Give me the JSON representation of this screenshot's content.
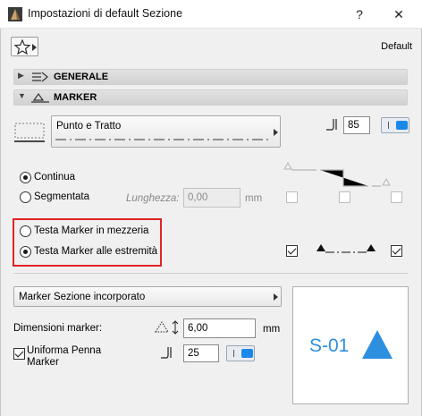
{
  "window": {
    "title": "Impostazioni di default Sezione",
    "help_label": "?",
    "close_label": "✕"
  },
  "toolbar": {
    "default_label": "Default"
  },
  "sections": {
    "generale": {
      "label": "GENERALE",
      "state": "collapsed"
    },
    "marker": {
      "label": "MARKER",
      "state": "expanded"
    }
  },
  "line": {
    "type_value": "Punto e Tratto",
    "pen_value": "85"
  },
  "style": {
    "continua_label": "Continua",
    "segmentata_label": "Segmentata",
    "lunghezza_label": "Lunghezza:",
    "lunghezza_value": "0,00",
    "lunghezza_unit": "mm",
    "selected": "continua"
  },
  "marker_position": {
    "mezzeria_label": "Testa Marker in mezzeria",
    "estremita_label": "Testa Marker alle estremità",
    "selected": "estremita"
  },
  "marker_type": {
    "value": "Marker Sezione incorporato"
  },
  "dimensions": {
    "label": "Dimensioni marker:",
    "value": "6,00",
    "unit": "mm"
  },
  "uniform_pen": {
    "label_line1": "Uniforma Penna",
    "label_line2": "Marker",
    "checked": true,
    "pen_value": "25"
  },
  "preview": {
    "label": "S-01"
  },
  "colors": {
    "accent": "#1a88e8",
    "highlight_box": "#e02424",
    "preview_text": "#2d8fe0"
  }
}
